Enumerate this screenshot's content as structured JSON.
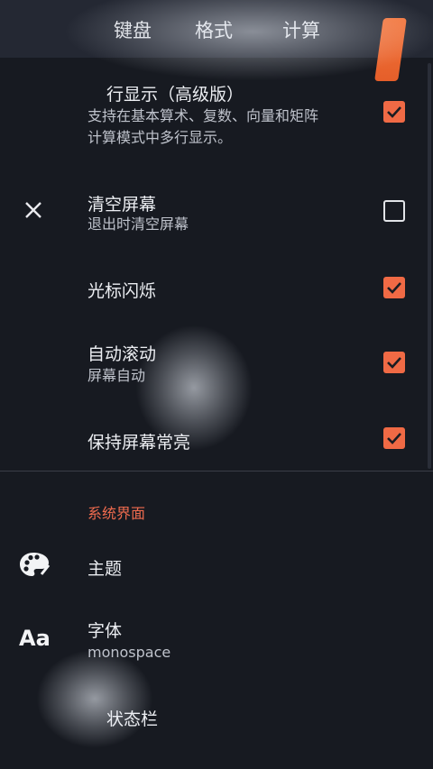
{
  "tabs": [
    {
      "label": "键盘"
    },
    {
      "label": "格式"
    },
    {
      "label": "计算"
    }
  ],
  "settings": [
    {
      "title": "行显示（高级版）",
      "subtitle_line1": "支持在基本算术、复数、向量和矩阵",
      "subtitle_line2": "计算模式中多行显示。",
      "checked": true
    },
    {
      "title": "清空屏幕",
      "subtitle": "退出时清空屏幕",
      "checked": false
    },
    {
      "title": "光标闪烁",
      "checked": true
    },
    {
      "title": "自动滚动",
      "subtitle": "屏幕自动",
      "checked": true
    },
    {
      "title": "保持屏幕常亮",
      "checked": true
    }
  ],
  "section_title": "系统界面",
  "ui_items": [
    {
      "title": "主题",
      "icon": "palette-icon"
    },
    {
      "title": "字体",
      "subtitle": "monospace",
      "icon": "font-icon",
      "icon_text": "Aa"
    },
    {
      "title": "状态栏"
    }
  ],
  "colors": {
    "accent": "#f06a45",
    "background": "#171a21",
    "tabbar": "#242833",
    "section": "#ef6b4e"
  }
}
